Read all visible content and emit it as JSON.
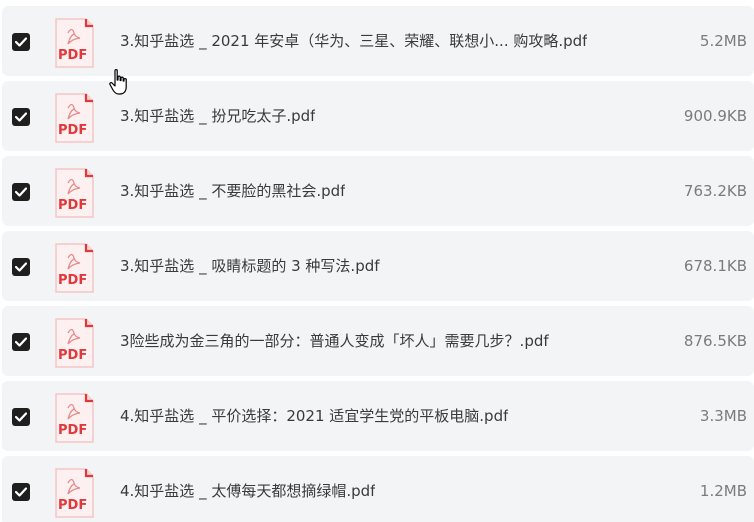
{
  "files": [
    {
      "name": "3.知乎盐选 _ 2021 年安卓（华为、三星、荣耀、联想小...  购攻略.pdf",
      "size": "5.2MB",
      "checked": true,
      "icon": "pdf-icon",
      "icon_label": "PDF"
    },
    {
      "name": "3.知乎盐选 _ 扮兄吃太子.pdf",
      "size": "900.9KB",
      "checked": true,
      "icon": "pdf-icon",
      "icon_label": "PDF"
    },
    {
      "name": "3.知乎盐选 _ 不要脸的黑社会.pdf",
      "size": "763.2KB",
      "checked": true,
      "icon": "pdf-icon",
      "icon_label": "PDF"
    },
    {
      "name": "3.知乎盐选 _ 吸睛标题的 3 种写法.pdf",
      "size": "678.1KB",
      "checked": true,
      "icon": "pdf-icon",
      "icon_label": "PDF"
    },
    {
      "name": "3险些成为金三角的一部分：普通人变成「坏人」需要几步？.pdf",
      "size": "876.5KB",
      "checked": true,
      "icon": "pdf-icon",
      "icon_label": "PDF"
    },
    {
      "name": "4.知乎盐选 _ 平价选择：2021 适宜学生党的平板电脑.pdf",
      "size": "3.3MB",
      "checked": true,
      "icon": "pdf-icon",
      "icon_label": "PDF"
    },
    {
      "name": "4.知乎盐选 _ 太傅每天都想摘绿帽.pdf",
      "size": "1.2MB",
      "checked": true,
      "icon": "pdf-icon",
      "icon_label": "PDF"
    }
  ],
  "colors": {
    "row_bg": "#f3f4f6",
    "checkbox": "#1f1f1f",
    "pdf_red": "#e0383b",
    "pdf_bg": "#fdf0f0"
  }
}
